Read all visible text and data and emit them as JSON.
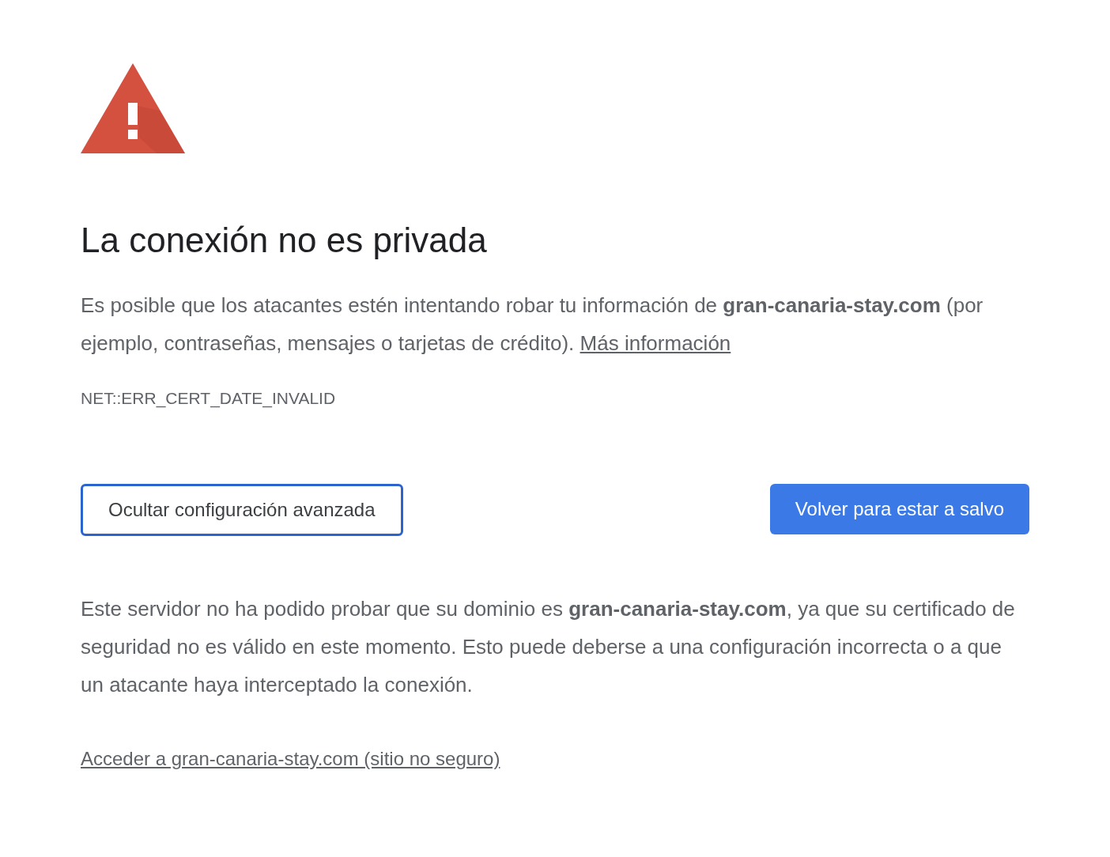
{
  "title": "La conexión no es privada",
  "intro": {
    "text": "Es posible que los atacantes estén intentando robar tu información de **gran-canaria-stay.com** (por ejemplo, contraseñas, mensajes o tarjetas de crédito).",
    "link": "Más información"
  },
  "error_code": "NET::ERR_CERT_DATE_INVALID",
  "buttons": [
    {
      "label": "Ocultar configuración avanzada",
      "kind": "secondary"
    },
    {
      "label": "Volver para estar a salvo",
      "kind": "primary"
    }
  ],
  "details": "Este servidor no ha podido probar que su dominio es **gran-canaria-stay.com**, ya que su certificado de seguridad no es válido en este momento. Esto puede deberse a una configuración incorrecta o a que un atacante haya interceptado la conexión.",
  "proceed_link": "Acceder a gran-canaria-stay.com (sitio no seguro)"
}
